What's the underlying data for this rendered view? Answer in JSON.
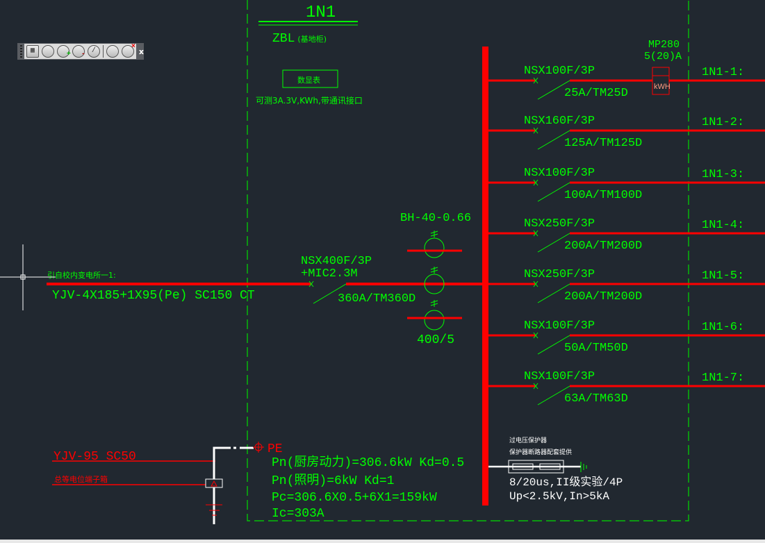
{
  "colors": {
    "background": "#212830",
    "text": "#00ff00",
    "power_line": "#ff0000",
    "cursor": "#ffffff"
  },
  "toolbar": {
    "buttons": [
      "view-cube-icon",
      "orbit-icon",
      "orbit-add-icon",
      "orbit-remove-icon",
      "orbit-free-icon",
      "camera-icon",
      "camera-delete-icon"
    ],
    "close_label": "x"
  },
  "panel": {
    "title": "1N1",
    "type": "ZBL",
    "type_note": "(基地柜)",
    "meter_label": "数显表",
    "meter_desc": "可测3A.3V,KWh,带通讯接口"
  },
  "incoming": {
    "source": "引自校内变电所一1:",
    "cable": "YJV-4X185+1X95(Pe)  SC150 CT",
    "breaker": "NSX400F/3P",
    "trip_unit": "+MIC2.3M",
    "rating": "360A/TM360D",
    "ct_model": "BH-40-0.66",
    "ct_ratio": "400/5"
  },
  "feeders": [
    {
      "breaker": "NSX100F/3P",
      "rating": "25A/TM25D",
      "circuit": "1N1-1:"
    },
    {
      "breaker": "NSX160F/3P",
      "rating": "125A/TM125D",
      "circuit": "1N1-2:"
    },
    {
      "breaker": "NSX100F/3P",
      "rating": "100A/TM100D",
      "circuit": "1N1-3:"
    },
    {
      "breaker": "NSX250F/3P",
      "rating": "200A/TM200D",
      "circuit": "1N1-4:"
    },
    {
      "breaker": "NSX250F/3P",
      "rating": "200A/TM200D",
      "circuit": "1N1-5:"
    },
    {
      "breaker": "NSX100F/3P",
      "rating": "50A/TM50D",
      "circuit": "1N1-6:"
    },
    {
      "breaker": "NSX100F/3P",
      "rating": "63A/TM63D",
      "circuit": "1N1-7:"
    }
  ],
  "energy_meter": {
    "model": "MP280",
    "current": "5(20)A",
    "unit": "kWH"
  },
  "grounding": {
    "cable": "YJV-95 SC50",
    "box": "总等电位端子箱",
    "pe": "PE"
  },
  "load_calc": {
    "line1": "Pn(厨房动力)=306.6kW Kd=0.5",
    "line2": "Pn(照明)=6kW Kd=1",
    "line3": "Pc=306.6X0.5+6X1=159kW",
    "line4": "Ic=303A"
  },
  "spd": {
    "title": "过电压保护器",
    "note": "保护器断路器配套提供",
    "spec1": "8/20us,II级实验/4P",
    "spec2": "Up<2.5kV,In>5kA"
  }
}
